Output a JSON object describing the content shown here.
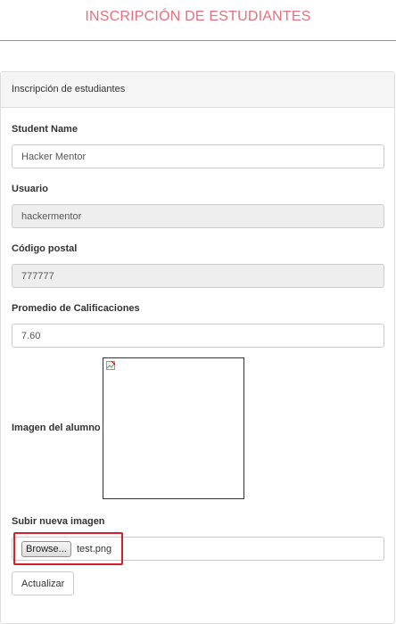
{
  "header": {
    "title": "INSCRIPCIÓN DE ESTUDIANTES"
  },
  "panel": {
    "heading": "Inscripción de estudiantes"
  },
  "form": {
    "student_name": {
      "label": "Student Name",
      "value": "Hacker Mentor"
    },
    "usuario": {
      "label": "Usuario",
      "value": "hackermentor"
    },
    "codigo_postal": {
      "label": "Código postal",
      "value": "777777"
    },
    "promedio": {
      "label": "Promedio de Calificaciones",
      "value": "7.60"
    },
    "imagen": {
      "label": "Imagen del alumno",
      "icon": "broken-image-icon"
    },
    "upload": {
      "label": "Subir nueva imagen",
      "browse_label": "Browse...",
      "file_name": "test.png"
    },
    "submit_label": "Actualizar"
  },
  "colors": {
    "accent": "#e5707f",
    "highlight": "#d4202b",
    "readonly_bg": "#eeeeee"
  }
}
